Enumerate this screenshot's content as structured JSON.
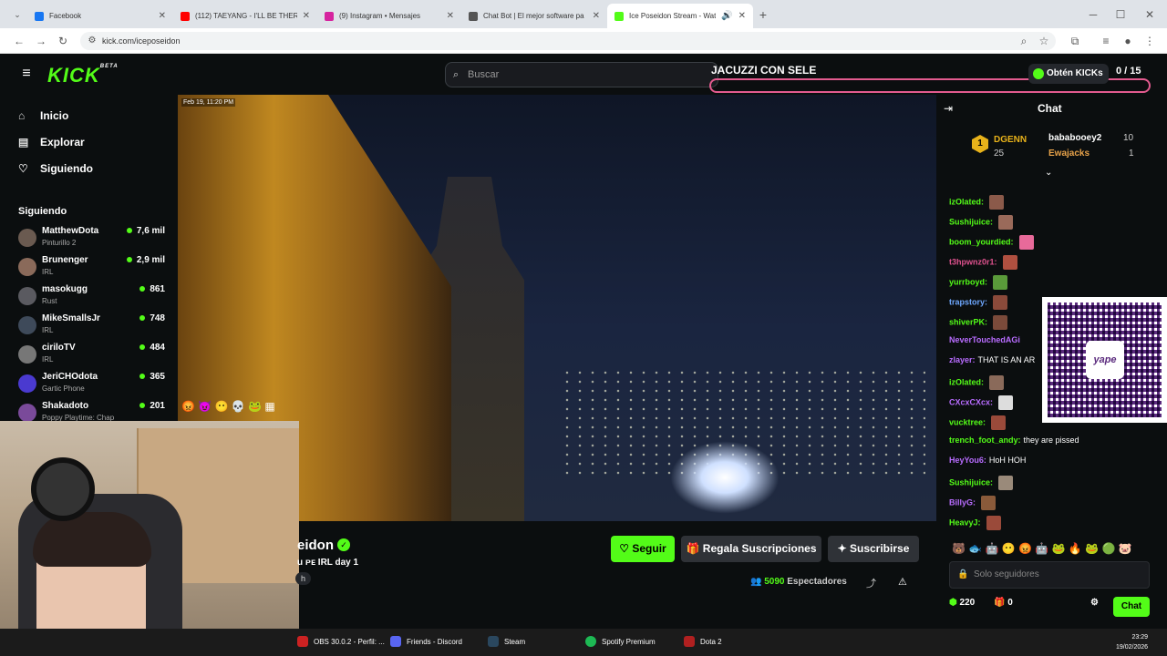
{
  "browser": {
    "tabs": [
      {
        "label": "Facebook",
        "color": "#1877f2"
      },
      {
        "label": "(112) TAEYANG - I'LL BE THERE",
        "color": "#ff0000"
      },
      {
        "label": "(9) Instagram • Mensajes",
        "color": "#d6249f"
      },
      {
        "label": "Chat Bot | El mejor software pa",
        "color": "#555555"
      },
      {
        "label": "Ice Poseidon Stream - Wat",
        "color": "#53fc18"
      }
    ],
    "url": "kick.com/iceposeidon"
  },
  "header": {
    "logo": "KICK",
    "logo_badge": "BETA",
    "search_placeholder": "Buscar",
    "banner_text": "JACUZZI CON SELE",
    "get_kicks": "Obtén KICKs",
    "counter": "0 / 15"
  },
  "sidebar": {
    "nav": [
      {
        "label": "Inicio",
        "icon": "home-icon"
      },
      {
        "label": "Explorar",
        "icon": "browse-icon"
      },
      {
        "label": "Siguiendo",
        "icon": "heart-icon"
      }
    ],
    "following_title": "Siguiendo",
    "following": [
      {
        "name": "MatthewDota",
        "category": "Pinturillo 2",
        "viewers": "7,6 mil"
      },
      {
        "name": "Brunenger",
        "category": "IRL",
        "viewers": "2,9 mil"
      },
      {
        "name": "masokugg",
        "category": "Rust",
        "viewers": "861"
      },
      {
        "name": "MikeSmallsJr",
        "category": "IRL",
        "viewers": "748"
      },
      {
        "name": "ciriloTV",
        "category": "IRL",
        "viewers": "484"
      },
      {
        "name": "JeriCHOdota",
        "category": "Gartic Phone",
        "viewers": "365"
      },
      {
        "name": "Shakadoto",
        "category": "Poppy Playtime: Chap",
        "viewers": "201"
      }
    ]
  },
  "video": {
    "timestamp": "Feb 19, 11:20 PM"
  },
  "stream": {
    "channel": "eidon",
    "title": "u ᴘᴇ IRL day 1",
    "tag": "h",
    "follow": "Seguir",
    "gift": "Regala Suscripciones",
    "subscribe": "Suscribirse",
    "viewers_count": "5090",
    "viewers_label": "Espectadores"
  },
  "chat": {
    "title": "Chat",
    "leaderboard": {
      "rank": "1",
      "top_user": "DGENN",
      "top_count": "25",
      "second_user": "bababooey2",
      "second_count": "10",
      "third_user": "Ewajacks",
      "third_count": "1"
    },
    "messages": [
      {
        "user": "izOlated:",
        "text": "",
        "color": "#53fc18"
      },
      {
        "user": "Sushijuice:",
        "text": "",
        "color": "#53fc18"
      },
      {
        "user": "boom_yourdied:",
        "text": "",
        "color": "#53fc18"
      },
      {
        "user": "t3hpwnz0r1:",
        "text": "",
        "color": "#e0528f"
      },
      {
        "user": "yurrboyd:",
        "text": "",
        "color": "#53fc18"
      },
      {
        "user": "trapstory:",
        "text": "",
        "color": "#6ea8ff"
      },
      {
        "user": "shiverPK:",
        "text": "",
        "color": "#53fc18"
      },
      {
        "user": "NeverTouchedAGi",
        "text": "",
        "color": "#b86cff"
      },
      {
        "user": "zlayer:",
        "text": "THAT IS AN AR",
        "color": "#b86cff"
      },
      {
        "user": "izOlated:",
        "text": "",
        "color": "#53fc18"
      },
      {
        "user": "CXcxCXcx:",
        "text": "",
        "color": "#b86cff"
      },
      {
        "user": "vucktree:",
        "text": "",
        "color": "#53fc18"
      },
      {
        "user": "trench_foot_andy:",
        "text": "they are pissed",
        "color": "#53fc18"
      },
      {
        "user": "HeyYou6:",
        "text": "HoH HOH",
        "color": "#b86cff"
      },
      {
        "user": "Sushijuice:",
        "text": "",
        "color": "#53fc18"
      },
      {
        "user": "BillyG:",
        "text": "",
        "color": "#b86cff"
      },
      {
        "user": "HeavyJ:",
        "text": "",
        "color": "#53fc18"
      }
    ],
    "qr_label": "yape",
    "input_placeholder": "Solo seguidores",
    "points": "220",
    "gifts": "0",
    "send": "Chat"
  },
  "taskbar": {
    "items": [
      {
        "label": "OBS 30.0.2 - Perfil: ...",
        "color": "#cc2222"
      },
      {
        "label": "Friends - Discord",
        "color": "#5865f2"
      },
      {
        "label": "Steam",
        "color": "#1b2838"
      },
      {
        "label": "Spotify Premium",
        "color": "#1db954"
      },
      {
        "label": "Dota 2",
        "color": "#b02020"
      }
    ],
    "time": "23:29",
    "date": "19/02/2026"
  }
}
